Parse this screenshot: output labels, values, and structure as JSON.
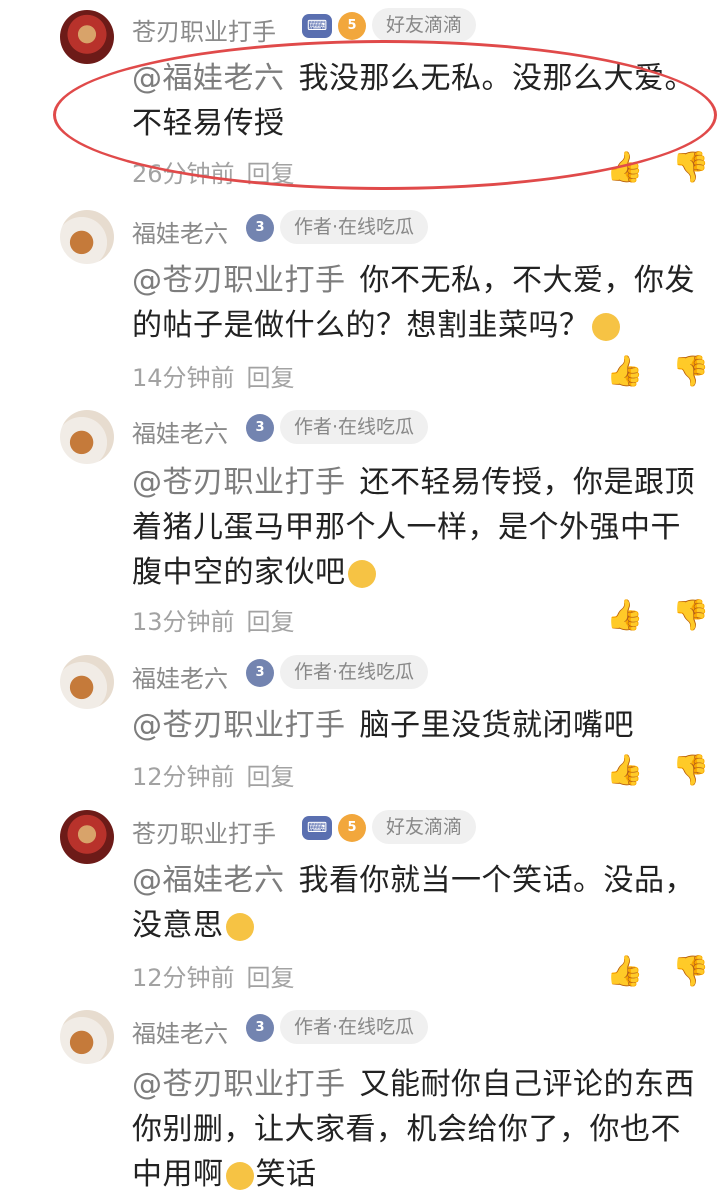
{
  "comments": [
    {
      "author": "苍刃职业打手",
      "tag": "好友滴滴",
      "level": "5",
      "mention": "@福娃老六",
      "text": "我没那么无私。没那么大爱。不轻易传授",
      "time": "26分钟前",
      "reply": "回复"
    },
    {
      "author": "福娃老六",
      "tag": "作者·在线吃瓜",
      "level": "3",
      "mention": "@苍刃职业打手",
      "text": "你不无私，不大爱，你发的帖子是做什么的？想割韭菜吗？",
      "time": "14分钟前",
      "reply": "回复"
    },
    {
      "author": "福娃老六",
      "tag": "作者·在线吃瓜",
      "level": "3",
      "mention": "@苍刃职业打手",
      "text": "还不轻易传授，你是跟顶着猪儿蛋马甲那个人一样，是个外强中干腹中空的家伙吧",
      "time": "13分钟前",
      "reply": "回复"
    },
    {
      "author": "福娃老六",
      "tag": "作者·在线吃瓜",
      "level": "3",
      "mention": "@苍刃职业打手",
      "text": "脑子里没货就闭嘴吧",
      "time": "12分钟前",
      "reply": "回复"
    },
    {
      "author": "苍刃职业打手",
      "tag": "好友滴滴",
      "level": "5",
      "mention": "@福娃老六",
      "text": "我看你就当一个笑话。没品，没意思",
      "time": "12分钟前",
      "reply": "回复"
    },
    {
      "author": "福娃老六",
      "tag": "作者·在线吃瓜",
      "level": "3",
      "mention": "@苍刃职业打手",
      "text": "又能耐你自己评论的东西你别删，让大家看，机会给你了，你也不中用啊",
      "text_tail": "笑话"
    }
  ],
  "icons": {
    "like": "thumbs-up-icon",
    "dislike": "thumbs-down-icon",
    "emoji": "emoji-icon"
  },
  "colors": {
    "highlight_ellipse": "#e04a4a",
    "tag_bg": "#f0f0f0",
    "level_gold": "#f2a73c",
    "level_blue": "#7384b0"
  }
}
